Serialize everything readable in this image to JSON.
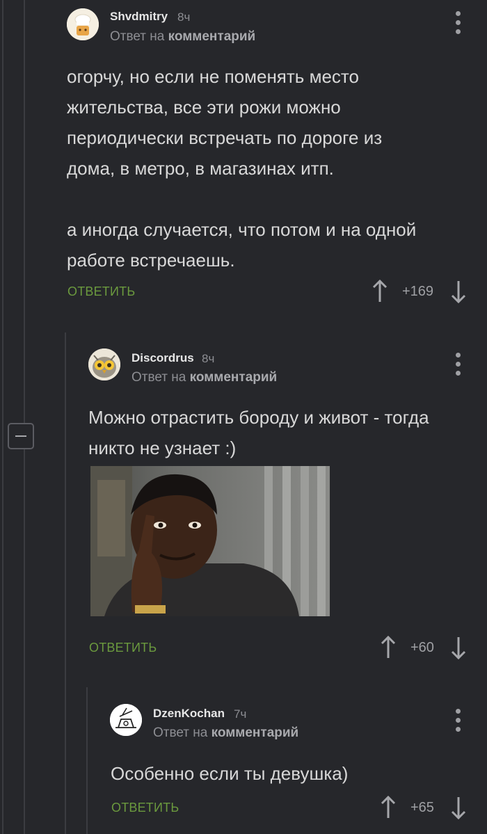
{
  "comments": [
    {
      "username": "Shvdmitry",
      "time": "8ч",
      "reply_prefix": "Ответ на",
      "reply_link": "комментарий",
      "text_lines": [
        "огорчу, но если не поменять место",
        "жительства, все эти рожи можно",
        "периодически встречать по дороге из",
        "дома, в метро, в магазинах итп.",
        "",
        "а иногда случается, что потом и на одной",
        "работе встречаешь."
      ],
      "reply_label": "ОТВЕТИТЬ",
      "rating": "+169",
      "avatar_icon": "chef-avatar-icon"
    },
    {
      "username": "Discordrus",
      "time": "8ч",
      "reply_prefix": "Ответ на",
      "reply_link": "комментарий",
      "text_lines": [
        "Можно отрастить бороду и живот - тогда",
        "никто не узнает :)"
      ],
      "reply_label": "ОТВЕТИТЬ",
      "rating": "+60",
      "avatar_icon": "owl-avatar-icon",
      "image": "meme-thinking-man"
    },
    {
      "username": "DzenKochan",
      "time": "7ч",
      "reply_prefix": "Ответ на",
      "reply_link": "комментарий",
      "text_lines": [
        "Особенно если ты девушка)"
      ],
      "reply_label": "ОТВЕТИТЬ",
      "rating": "+65",
      "avatar_icon": "sketch-avatar-icon"
    }
  ],
  "colors": {
    "background": "#26272b",
    "reply_green": "#6b9a3e",
    "thread_line": "#3b3c41"
  }
}
